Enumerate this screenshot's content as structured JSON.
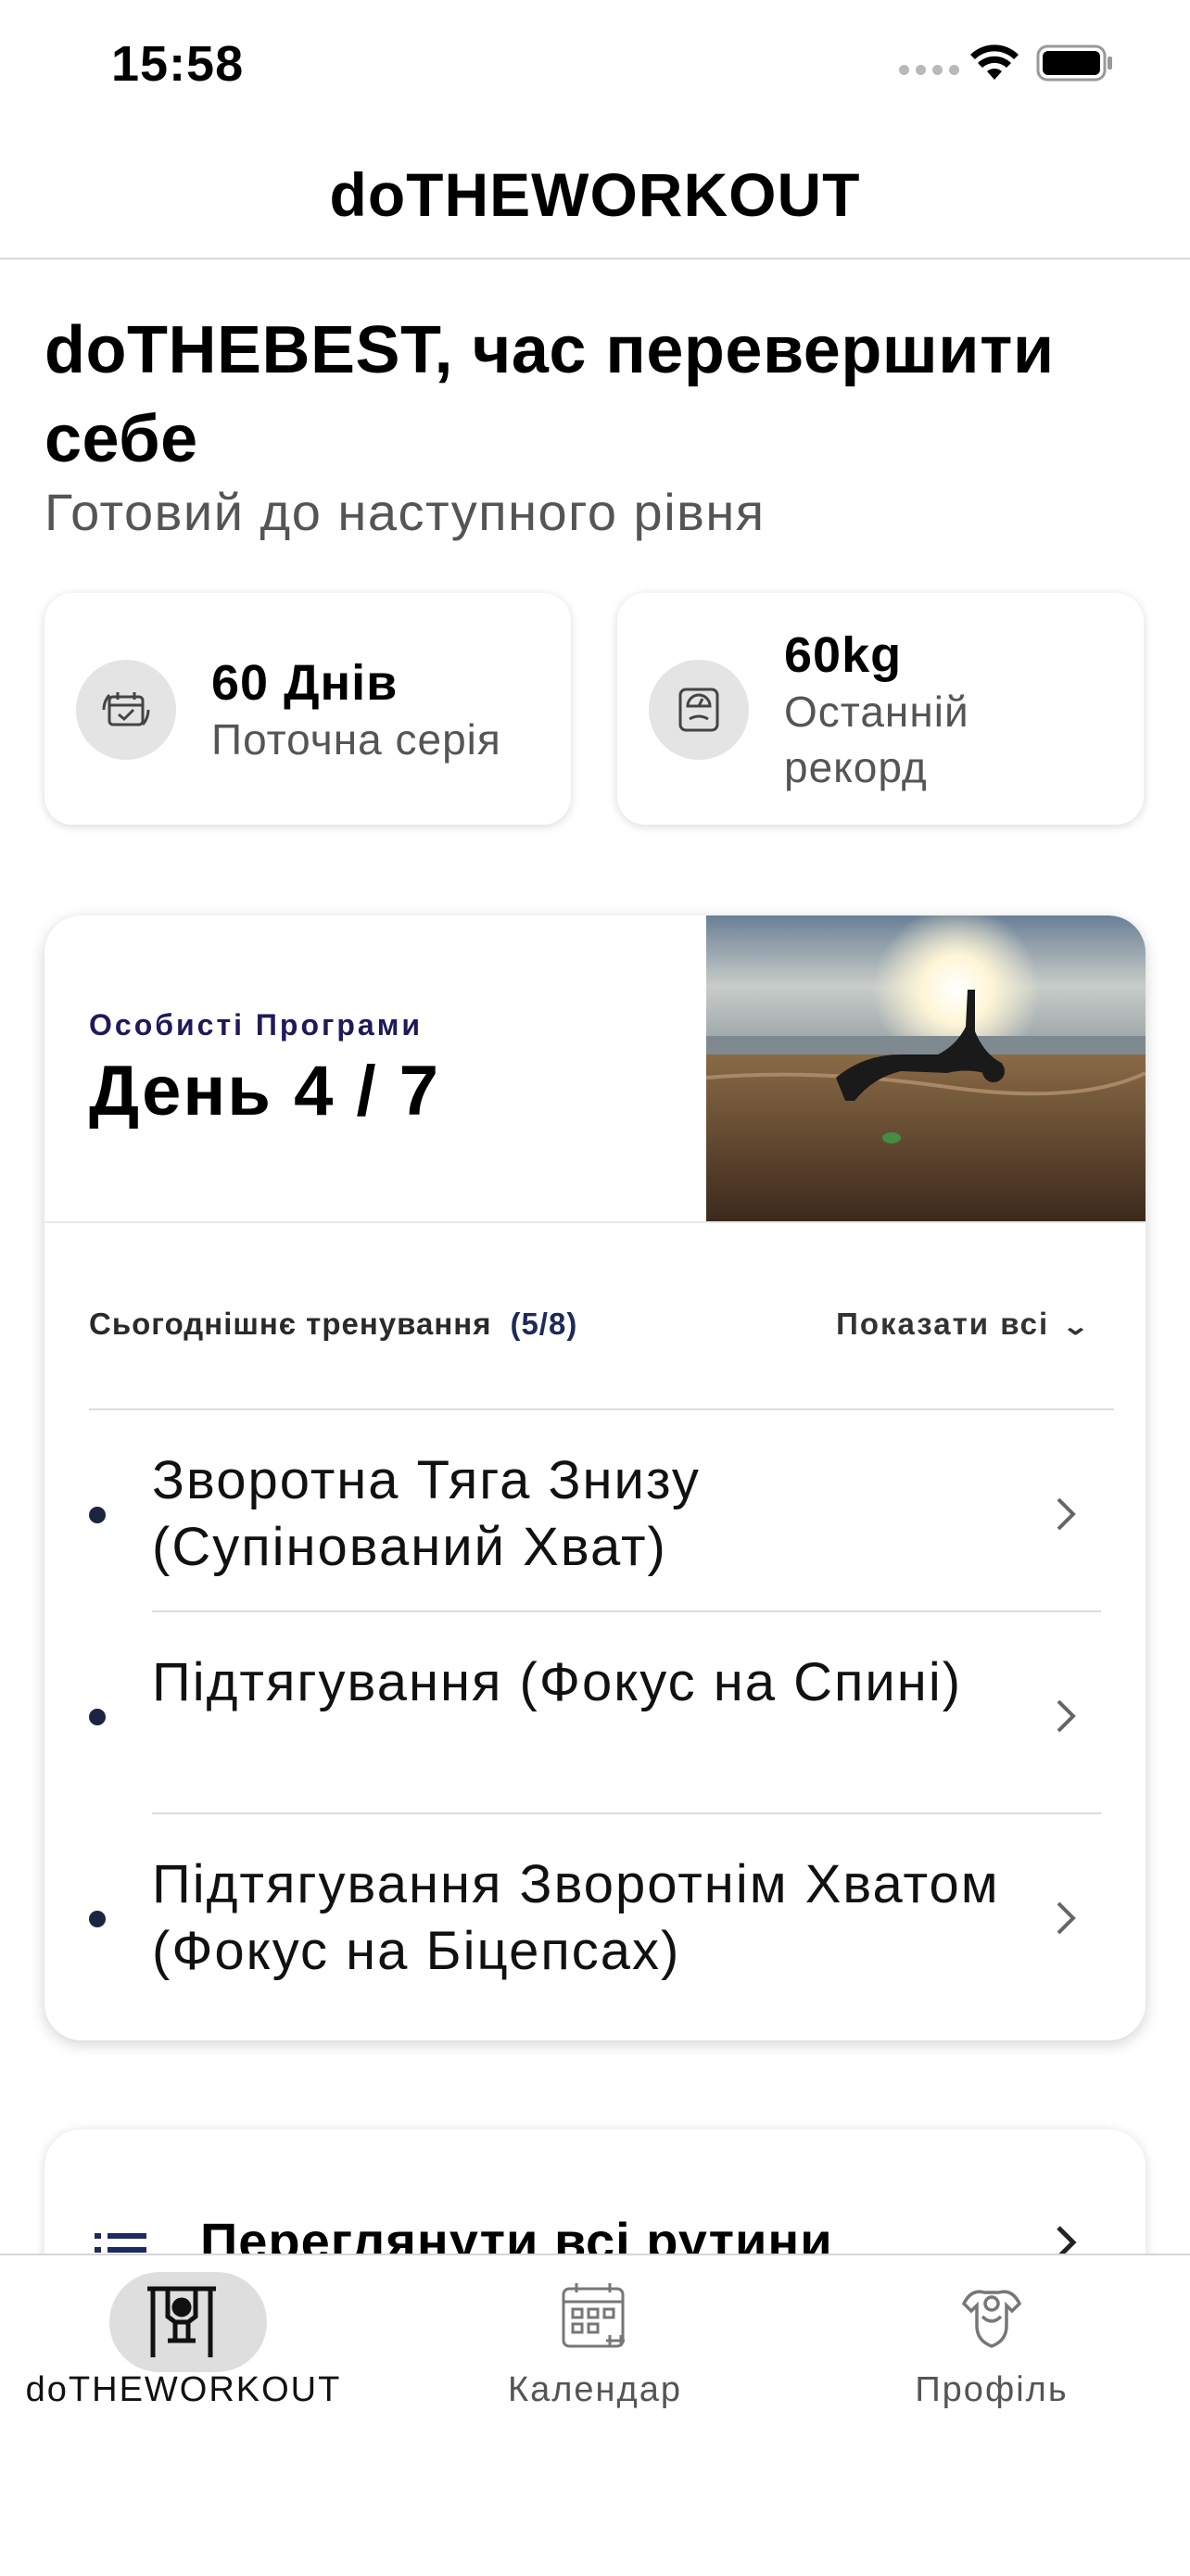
{
  "status_bar": {
    "time": "15:58"
  },
  "header": {
    "title": "doTHEWORKOUT"
  },
  "greeting": {
    "title": "doTHEBEST, час перевершити себе",
    "subtitle": "Готовий до наступного рівня"
  },
  "stats": [
    {
      "value": "60 Днів",
      "label": "Поточна серія",
      "icon": "calendar-check-icon"
    },
    {
      "value": "60kg",
      "label": "Останній рекорд",
      "icon": "scale-icon"
    }
  ],
  "program": {
    "label": "Особисті Програми",
    "day": "День 4 / 7",
    "today_label": "Сьогоднішнє тренування",
    "today_count": "(5/8)",
    "show_all": "Показати всі",
    "exercises": [
      {
        "name": "Зворотна Тяга Знизу (Супінований Хват)"
      },
      {
        "name": "Підтягування (Фокус на Спині)"
      },
      {
        "name": "Підтягування Зворотнім Хватом (Фокус на Біцепсах)"
      }
    ]
  },
  "routines": {
    "label": "Переглянути всі рутини"
  },
  "tabs": [
    {
      "label": "doTHEWORKOUT",
      "icon": "pullup-bar-icon",
      "active": true
    },
    {
      "label": "Календар",
      "icon": "calendar-icon",
      "active": false
    },
    {
      "label": "Профіль",
      "icon": "profile-icon",
      "active": false
    }
  ]
}
